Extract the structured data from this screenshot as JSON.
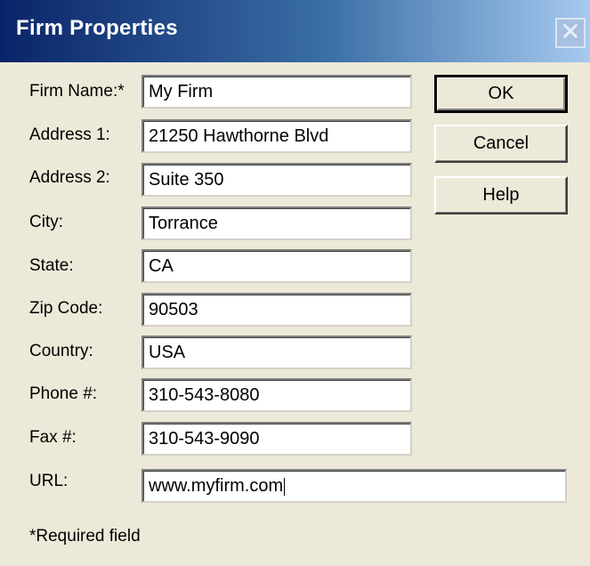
{
  "window": {
    "title": "Firm Properties",
    "close_glyph": "✕"
  },
  "form": {
    "firm_name": {
      "label": "Firm Name:*",
      "value": "My Firm"
    },
    "address1": {
      "label": "Address 1:",
      "value": "21250 Hawthorne Blvd"
    },
    "address2": {
      "label": "Address 2:",
      "value": "Suite 350"
    },
    "city": {
      "label": "City:",
      "value": "Torrance"
    },
    "state": {
      "label": "State:",
      "value": "CA"
    },
    "zip": {
      "label": "Zip Code:",
      "value": "90503"
    },
    "country": {
      "label": "Country:",
      "value": "USA"
    },
    "phone": {
      "label": "Phone #:",
      "value": "310-543-8080"
    },
    "fax": {
      "label": "Fax #:",
      "value": "310-543-9090"
    },
    "url": {
      "label": "URL:",
      "value": "www.myfirm.com"
    }
  },
  "buttons": {
    "ok": "OK",
    "cancel": "Cancel",
    "help": "Help"
  },
  "note": "*Required field"
}
